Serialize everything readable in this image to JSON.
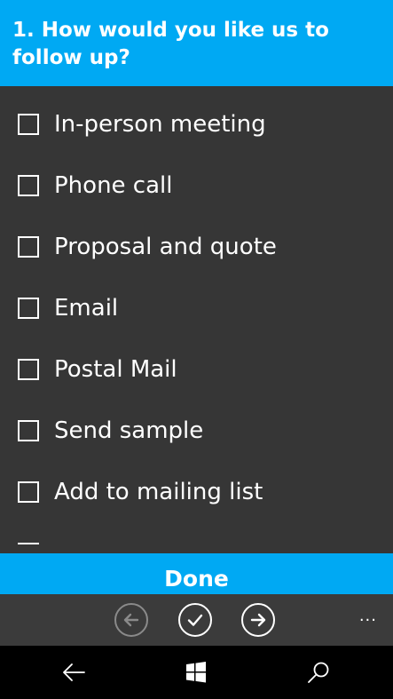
{
  "header": {
    "title": "1. How would you like us to follow up?"
  },
  "options": [
    {
      "label": "In-person meeting",
      "checked": false
    },
    {
      "label": "Phone call",
      "checked": false
    },
    {
      "label": "Proposal and quote",
      "checked": false
    },
    {
      "label": "Email",
      "checked": false
    },
    {
      "label": "Postal Mail",
      "checked": false
    },
    {
      "label": "Send sample",
      "checked": false
    },
    {
      "label": "Add to mailing list",
      "checked": false
    }
  ],
  "done_bar": {
    "label": "Done"
  },
  "app_bar": {
    "more": "..."
  },
  "colors": {
    "accent": "#00a9f3",
    "background": "#363636",
    "nav_bar": "#000000",
    "disabled_icon": "#8a8a8a"
  },
  "icons": {
    "previous": "back-arrow-circle-icon",
    "confirm": "checkmark-circle-icon",
    "next": "forward-arrow-circle-icon",
    "nav_back": "back-arrow-icon",
    "nav_home": "windows-logo-icon",
    "nav_search": "search-icon"
  }
}
